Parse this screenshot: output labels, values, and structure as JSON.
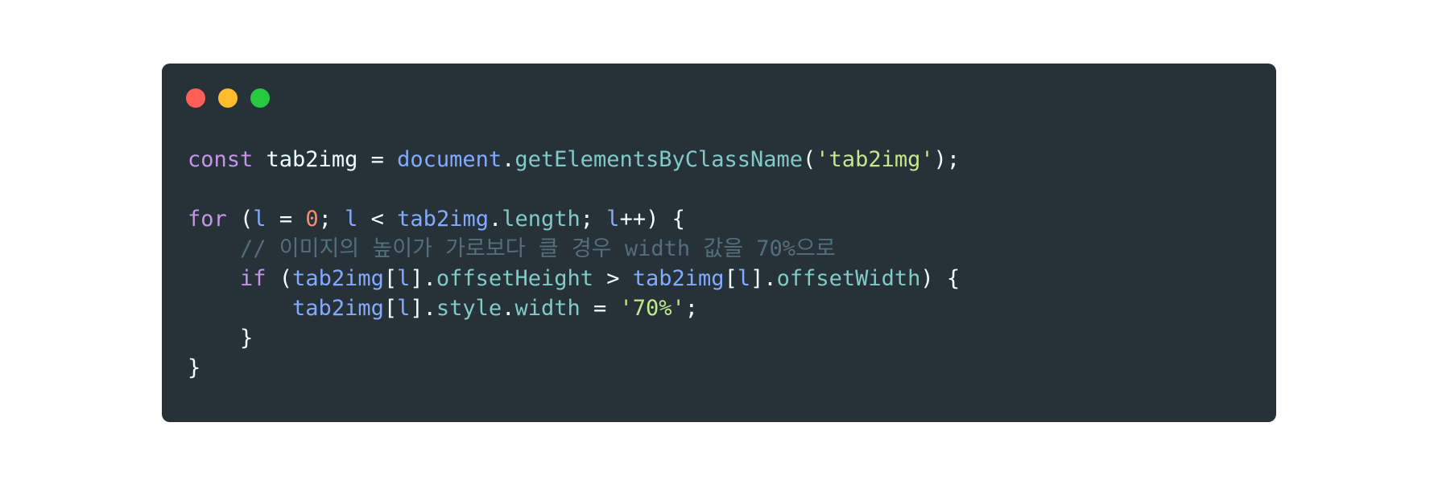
{
  "window": {
    "controls": [
      {
        "name": "close",
        "color": "#ff5f56"
      },
      {
        "name": "minimize",
        "color": "#ffbd2e"
      },
      {
        "name": "maximize",
        "color": "#27c93f"
      }
    ]
  },
  "code": {
    "lines": [
      [
        {
          "t": "const",
          "type": "keyword"
        },
        {
          "t": " tab2img = ",
          "type": "plain"
        },
        {
          "t": "document",
          "type": "object"
        },
        {
          "t": ".",
          "type": "plain"
        },
        {
          "t": "getElementsByClassName",
          "type": "property"
        },
        {
          "t": "(",
          "type": "plain"
        },
        {
          "t": "'tab2img'",
          "type": "string"
        },
        {
          "t": ");",
          "type": "plain"
        }
      ],
      [],
      [
        {
          "t": "for",
          "type": "keyword"
        },
        {
          "t": " (",
          "type": "plain"
        },
        {
          "t": "l",
          "type": "object"
        },
        {
          "t": " = ",
          "type": "plain"
        },
        {
          "t": "0",
          "type": "number"
        },
        {
          "t": "; ",
          "type": "plain"
        },
        {
          "t": "l",
          "type": "object"
        },
        {
          "t": " < ",
          "type": "plain"
        },
        {
          "t": "tab2img",
          "type": "object"
        },
        {
          "t": ".",
          "type": "plain"
        },
        {
          "t": "length",
          "type": "property"
        },
        {
          "t": "; ",
          "type": "plain"
        },
        {
          "t": "l",
          "type": "object"
        },
        {
          "t": "++) {",
          "type": "plain"
        }
      ],
      [
        {
          "t": "    // 이미지의 높이가 가로보다 클 경우 width 값을 70%으로",
          "type": "comment"
        }
      ],
      [
        {
          "t": "    ",
          "type": "plain"
        },
        {
          "t": "if",
          "type": "keyword"
        },
        {
          "t": " (",
          "type": "plain"
        },
        {
          "t": "tab2img",
          "type": "object"
        },
        {
          "t": "[",
          "type": "plain"
        },
        {
          "t": "l",
          "type": "object"
        },
        {
          "t": "].",
          "type": "plain"
        },
        {
          "t": "offsetHeight",
          "type": "property"
        },
        {
          "t": " > ",
          "type": "plain"
        },
        {
          "t": "tab2img",
          "type": "object"
        },
        {
          "t": "[",
          "type": "plain"
        },
        {
          "t": "l",
          "type": "object"
        },
        {
          "t": "].",
          "type": "plain"
        },
        {
          "t": "offsetWidth",
          "type": "property"
        },
        {
          "t": ") {",
          "type": "plain"
        }
      ],
      [
        {
          "t": "        ",
          "type": "plain"
        },
        {
          "t": "tab2img",
          "type": "object"
        },
        {
          "t": "[",
          "type": "plain"
        },
        {
          "t": "l",
          "type": "object"
        },
        {
          "t": "].",
          "type": "plain"
        },
        {
          "t": "style",
          "type": "property"
        },
        {
          "t": ".",
          "type": "plain"
        },
        {
          "t": "width",
          "type": "property"
        },
        {
          "t": " = ",
          "type": "plain"
        },
        {
          "t": "'70%'",
          "type": "string"
        },
        {
          "t": ";",
          "type": "plain"
        }
      ],
      [
        {
          "t": "    }",
          "type": "plain"
        }
      ],
      [
        {
          "t": "}",
          "type": "plain"
        }
      ]
    ]
  },
  "colors": {
    "background": "#ffffff",
    "window_bg": "#263238",
    "keyword": "#c792ea",
    "plain": "#eeffff",
    "object": "#82aaff",
    "property": "#80cbc4",
    "string": "#c3e88d",
    "number": "#f78c6c",
    "comment": "#546e7a"
  }
}
